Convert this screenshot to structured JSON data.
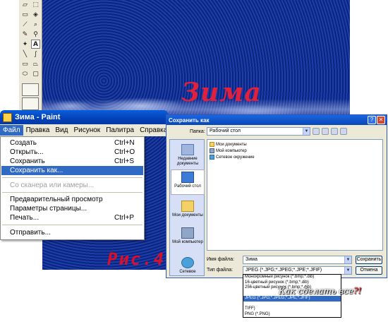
{
  "paint": {
    "title": "Зима - Paint",
    "menu": [
      "Файл",
      "Правка",
      "Вид",
      "Рисунок",
      "Палитра",
      "Справка"
    ],
    "file_menu": [
      {
        "label": "Создать",
        "shortcut": "Ctrl+N"
      },
      {
        "label": "Открыть...",
        "shortcut": "Ctrl+O"
      },
      {
        "label": "Сохранить",
        "shortcut": "Ctrl+S"
      },
      {
        "label": "Сохранить как..."
      },
      {
        "label": "Со сканера или камеры..."
      },
      {
        "label": "Предварительный просмотр"
      },
      {
        "label": "Параметры страницы..."
      },
      {
        "label": "Печать...",
        "shortcut": "Ctrl+P"
      },
      {
        "label": "Отправить..."
      }
    ]
  },
  "canvas": {
    "caption": "Зима"
  },
  "figure_label": "Рис.4",
  "dialog": {
    "title": "Сохранить как",
    "folder_label": "Папка:",
    "folder_value": "Рабочий стол",
    "places": [
      "Недавние документы",
      "Рабочий стол",
      "Мои документы",
      "Мой компьютер",
      "Сетевое"
    ],
    "files": [
      "Мои документы",
      "Мой компьютер",
      "Сетевое окружение"
    ],
    "filename_label": "Имя файла:",
    "filename_value": "Зима",
    "filetype_label": "Тип файла:",
    "filetype_value": "JPEG (*.JPG;*.JPEG;*.JPE;*.JFIF)",
    "save_button": "Сохранить",
    "cancel_button": "Отмена",
    "type_options": [
      "Монохромный рисунок (*.bmp;*.dib)",
      "16-цветный рисунок (*.bmp;*.dib)",
      "256-цветный рисунок (*.bmp;*.dib)",
      "",
      "JPEG (*.JPG;*.JPEG;*.JPE;*.JFIF)",
      "",
      "TIFF)",
      "PNG (*.PNG)"
    ]
  },
  "watermark": {
    "text": "Как сделать все",
    "mark": "?!"
  },
  "colors": {
    "titlebar": "#0a5edb",
    "highlight": "#316ac5",
    "caption_red": "#e0203c"
  }
}
